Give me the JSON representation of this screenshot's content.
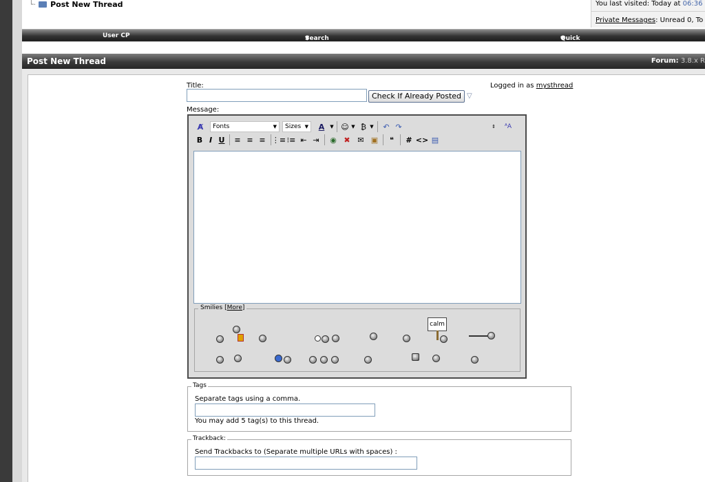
{
  "header": {
    "breadcrumb_title": "Post New Thread",
    "last_visited_label": "You last visited: Today at ",
    "last_visited_time": "06:36",
    "pm_link": "Private Messages",
    "pm_text": ": Unread 0, To"
  },
  "navbar": {
    "user_cp": "User CP",
    "search": "Search",
    "quick_links": "Quick Links"
  },
  "form": {
    "heading": "Post New Thread",
    "forum_label": "Forum:",
    "forum_value": "3.8.x R",
    "title_label": "Title:",
    "check_button": "Check If Already Posted",
    "logged_in_label": "Logged in as",
    "username": "mysthread",
    "message_label": "Message:"
  },
  "editor": {
    "font_select": "Fonts",
    "size_select": "Sizes",
    "smilies_label": "Smilies",
    "smilies_more": "More",
    "calm_sign": "calm"
  },
  "tags": {
    "legend": "Tags",
    "instruction": "Separate tags using a comma.",
    "note": "You may add 5 tag(s) to this thread."
  },
  "trackback": {
    "legend": "Trackback:",
    "instruction": "Send Trackbacks to (Separate multiple URLs with spaces) :"
  }
}
